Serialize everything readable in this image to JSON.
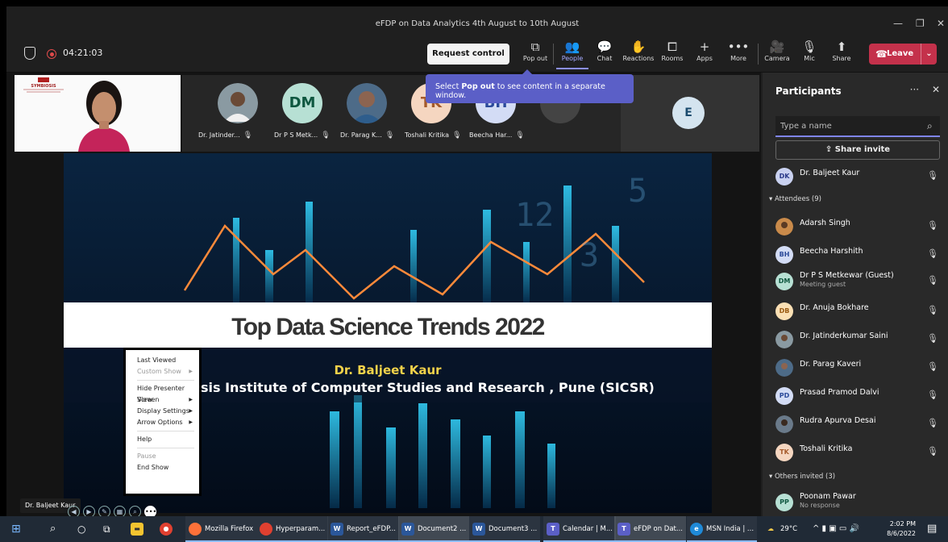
{
  "window": {
    "title": "eFDP on Data Analytics 4th August to 10th August",
    "controls": [
      "—",
      "❐",
      "✕"
    ]
  },
  "toolbar": {
    "timer": "04:21:03",
    "request_control_label": "Request control",
    "items": [
      {
        "label": "Pop out",
        "icon": "⧉"
      },
      {
        "label": "People",
        "icon": "👥"
      },
      {
        "label": "Chat",
        "icon": "💬"
      },
      {
        "label": "Reactions",
        "icon": "✋"
      },
      {
        "label": "Rooms",
        "icon": "⧠"
      },
      {
        "label": "Apps",
        "icon": "+"
      },
      {
        "label": "More",
        "icon": "•••"
      },
      {
        "label": "Camera",
        "icon": "🎥"
      },
      {
        "label": "Mic",
        "icon": "🎙"
      },
      {
        "label": "Share",
        "icon": "⬆"
      }
    ],
    "leave_label": "Leave"
  },
  "tooltip": {
    "prefix": "Select ",
    "bold": "Pop out",
    "suffix": " to see content in a separate window."
  },
  "self_video": {
    "logo_text": "SYMBIOSIS INSTITUTE OF COMPUTER STUDIES AND RESEARCH"
  },
  "thumbnails": [
    {
      "label": "Dr. Jatinder...",
      "initials": ""
    },
    {
      "label": "Dr P S Metk...",
      "initials": "DM"
    },
    {
      "label": "Dr. Parag K...",
      "initials": ""
    },
    {
      "label": "Toshali Kritika",
      "initials": "TK"
    },
    {
      "label": "Beecha Har...",
      "initials": "BH"
    }
  ],
  "extra_tile_initial": "E",
  "slide": {
    "title": "Top Data Science Trends 2022",
    "presenter": "Dr. Baljeet Kaur",
    "institute": "sis Institute of Computer Studies and Research , Pune (SICSR)"
  },
  "context_menu": {
    "items": [
      {
        "label": "Last Viewed",
        "disabled": false,
        "submenu": false
      },
      {
        "label": "Custom Show",
        "disabled": true,
        "submenu": true
      },
      {
        "label": "Hide Presenter View",
        "disabled": false,
        "submenu": false
      },
      {
        "label": "Screen",
        "disabled": false,
        "submenu": true
      },
      {
        "label": "Display Settings",
        "disabled": false,
        "submenu": true
      },
      {
        "label": "Arrow Options",
        "disabled": false,
        "submenu": true
      },
      {
        "label": "Help",
        "disabled": false,
        "submenu": false
      },
      {
        "label": "Pause",
        "disabled": true,
        "submenu": false
      },
      {
        "label": "End Show",
        "disabled": false,
        "submenu": false
      }
    ]
  },
  "name_badge": "Dr. Baljeet Kaur",
  "panel": {
    "title": "Participants",
    "search_placeholder": "Type a name",
    "share_invite": "Share invite",
    "presenter": {
      "name": "Dr. Baljeet Kaur",
      "initials": "DK"
    },
    "attendees_header": "Attendees (9)",
    "attendees": [
      {
        "name": "Adarsh Singh",
        "initials": "",
        "sub": ""
      },
      {
        "name": "Beecha Harshith",
        "initials": "BH",
        "sub": ""
      },
      {
        "name": "Dr P S Metkewar (Guest)",
        "initials": "DM",
        "sub": "Meeting guest"
      },
      {
        "name": "Dr. Anuja Bokhare",
        "initials": "DB",
        "sub": ""
      },
      {
        "name": "Dr. Jatinderkumar Saini",
        "initials": "",
        "sub": ""
      },
      {
        "name": "Dr. Parag Kaveri",
        "initials": "",
        "sub": ""
      },
      {
        "name": "Prasad Pramod Dalvi",
        "initials": "PD",
        "sub": ""
      },
      {
        "name": "Rudra Apurva Desai",
        "initials": "",
        "sub": ""
      },
      {
        "name": "Toshali Kritika",
        "initials": "TK",
        "sub": ""
      }
    ],
    "others_header": "Others invited (3)",
    "others": [
      {
        "name": "Poonam Pawar",
        "initials": "PP",
        "sub": "No response"
      }
    ]
  },
  "taskbar": {
    "apps": [
      {
        "label": "Mozilla Firefox"
      },
      {
        "label": "Hyperparam..."
      },
      {
        "label": "Report_eFDP..."
      },
      {
        "label": "Document2 ..."
      },
      {
        "label": "Document3 ..."
      },
      {
        "label": "Calendar | M..."
      },
      {
        "label": "eFDP on Dat..."
      },
      {
        "label": "MSN India | ..."
      }
    ],
    "weather": "29°C",
    "time": "2:02 PM",
    "date": "8/6/2022"
  }
}
